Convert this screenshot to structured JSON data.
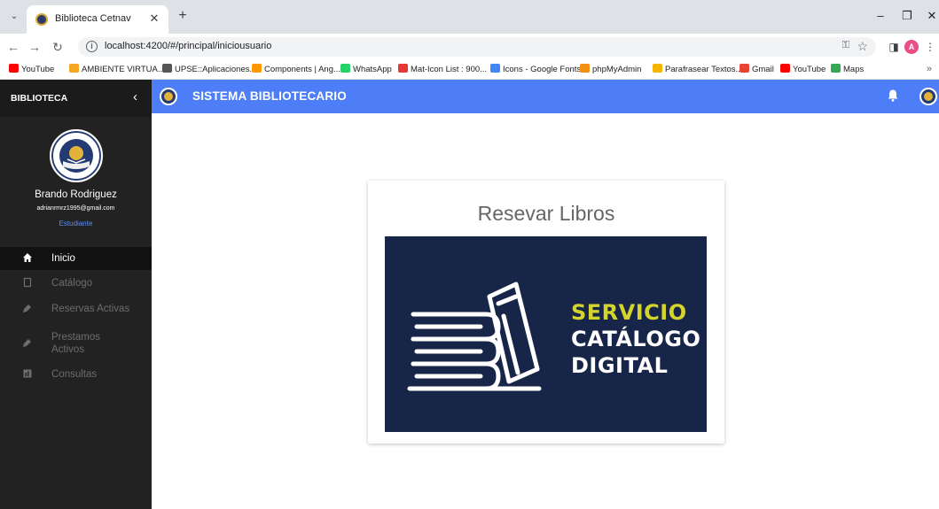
{
  "browser": {
    "tab_title": "Biblioteca Cetnav",
    "url": "localhost:4200/#/principal/iniciousuario",
    "profile_initial": "A",
    "bookmarks": [
      {
        "label": "YouTube",
        "color": "#ff0000"
      },
      {
        "label": "AMBIENTE VIRTUA...",
        "color": "#f5a623"
      },
      {
        "label": "UPSE::Aplicaciones...",
        "color": "#555555"
      },
      {
        "label": "Components | Ang...",
        "color": "#ff9800"
      },
      {
        "label": "WhatsApp",
        "color": "#25d366"
      },
      {
        "label": "Mat-Icon List : 900...",
        "color": "#e53935"
      },
      {
        "label": "Icons - Google Fonts",
        "color": "#4285f4"
      },
      {
        "label": "phpMyAdmin",
        "color": "#f29111"
      },
      {
        "label": "Parafrasear Textos...",
        "color": "#f4b400"
      },
      {
        "label": "Gmail",
        "color": "#ea4335"
      },
      {
        "label": "YouTube",
        "color": "#ff0000"
      },
      {
        "label": "Maps",
        "color": "#34a853"
      }
    ]
  },
  "sidebar": {
    "brand": "BIBLIOTECA",
    "user_name": "Brando Rodriguez",
    "user_email": "adrianrmrz1995@gmail.com",
    "user_role": "Estudiante",
    "items": [
      {
        "label": "Inicio",
        "icon": "home-icon",
        "active": true
      },
      {
        "label": "Catálogo",
        "icon": "book-icon",
        "active": false
      },
      {
        "label": "Reservas Activas",
        "icon": "bookmark-icon",
        "active": false
      },
      {
        "label": "Prestamos Activos",
        "icon": "bookmark-icon",
        "active": false
      },
      {
        "label": "Consultas",
        "icon": "chart-icon",
        "active": false
      }
    ]
  },
  "header": {
    "title": "SISTEMA BIBLIOTECARIO"
  },
  "main": {
    "card_title": "Resevar Libros",
    "banner_lines": [
      "SERVICIO",
      "CATÁLOGO",
      "DIGITAL"
    ]
  },
  "colors": {
    "accent": "#4d7ef7",
    "sidebar": "#222222",
    "banner_bg": "#172548",
    "banner_highlight": "#d4d42c"
  }
}
